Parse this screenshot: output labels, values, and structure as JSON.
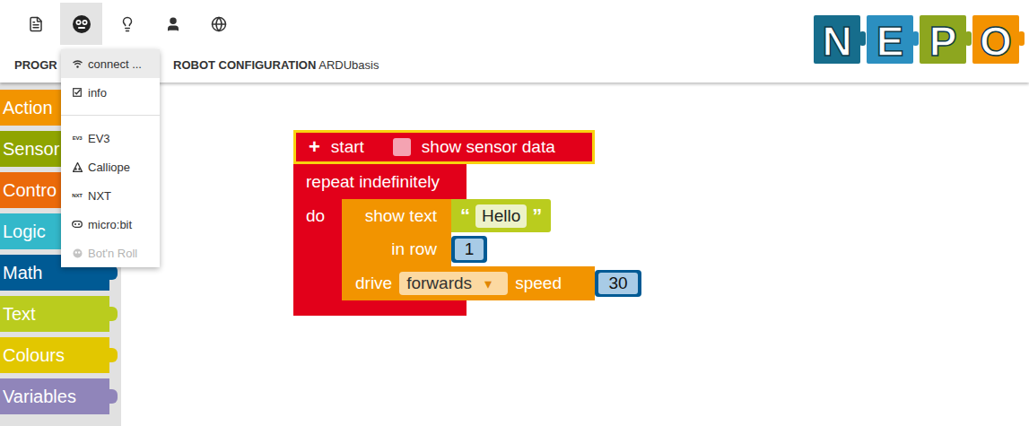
{
  "top_menu": [
    {
      "selected": false
    },
    {
      "selected": true
    },
    {
      "selected": false
    },
    {
      "selected": false
    },
    {
      "selected": false
    }
  ],
  "tabs": [
    {
      "label": "PROGR"
    },
    {
      "label": "ROBOT CONFIGURATION",
      "value": "ARDUbasis"
    }
  ],
  "logo": [
    {
      "letter": "N",
      "color": "#166d8c"
    },
    {
      "letter": "E",
      "color": "#2b8fc0"
    },
    {
      "letter": "P",
      "color": "#8da61f"
    },
    {
      "letter": "O",
      "color": "#f39200"
    }
  ],
  "dropdown": [
    {
      "kind": "item",
      "label": "connect ...",
      "highlighted": true,
      "disabled": false
    },
    {
      "kind": "item",
      "label": "info",
      "highlighted": false,
      "disabled": false
    },
    {
      "kind": "separator"
    },
    {
      "kind": "item",
      "label": "EV3",
      "badge": "EV3",
      "highlighted": false,
      "disabled": false
    },
    {
      "kind": "item",
      "label": "Calliope",
      "highlighted": false,
      "disabled": false
    },
    {
      "kind": "item",
      "label": "NXT",
      "badge": "NXT",
      "highlighted": false,
      "disabled": false
    },
    {
      "kind": "item",
      "label": "micro:bit",
      "highlighted": false,
      "disabled": false
    },
    {
      "kind": "item",
      "label": "Bot'n Roll",
      "highlighted": false,
      "disabled": true
    }
  ],
  "toolbox": [
    {
      "label": "Action",
      "color": "#f29400"
    },
    {
      "label": "Sensor",
      "color": "#8fa400"
    },
    {
      "label": "Contro",
      "color": "#eb6a0a"
    },
    {
      "label": "Logic",
      "color": "#33b8ca"
    },
    {
      "label": "Math",
      "color": "#005a94"
    },
    {
      "label": "Text",
      "color": "#bacc1e"
    },
    {
      "label": "Colours",
      "color": "#e2c700"
    },
    {
      "label": "Variables",
      "color": "#9085ba"
    }
  ],
  "program": {
    "start": {
      "plus": "+",
      "label": "start",
      "checkbox_label": "show sensor data",
      "checked": false,
      "selected": true
    },
    "loop": {
      "label": "repeat indefinitely",
      "do_label": "do"
    },
    "statements": [
      {
        "kind": "show_text",
        "label": "show text",
        "open_quote": "“",
        "text": "Hello",
        "close_quote": "”",
        "row_label": "in row",
        "row": "1"
      },
      {
        "kind": "drive",
        "label": "drive",
        "direction": "forwards",
        "arrow": "▾",
        "speed_label": "speed",
        "speed": "30"
      }
    ]
  }
}
